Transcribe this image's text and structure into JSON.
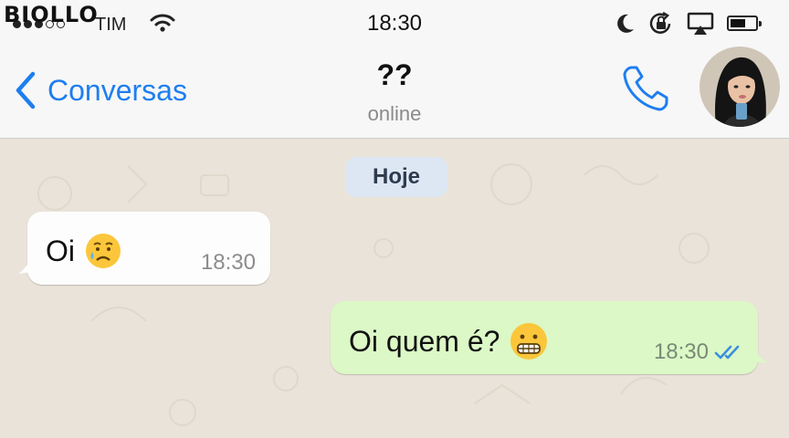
{
  "watermark": "BIOLLO",
  "status_bar": {
    "carrier": "TIM",
    "time": "18:30",
    "icons": [
      "signal-dots-icon",
      "wifi-icon",
      "moon-icon",
      "rotation-lock-icon",
      "airplay-icon",
      "battery-icon"
    ]
  },
  "nav": {
    "back_label": "Conversas",
    "contact_name": "??",
    "contact_status": "online",
    "icons": [
      "chevron-left-icon",
      "phone-icon"
    ]
  },
  "chat": {
    "date_label": "Hoje",
    "messages": [
      {
        "direction": "incoming",
        "text": "Oi",
        "emoji": "sad-sweat-face-emoji",
        "time": "18:30"
      },
      {
        "direction": "outgoing",
        "text": "Oi quem é?",
        "emoji": "grimacing-face-emoji",
        "time": "18:30",
        "status": "read-double-check-icon"
      }
    ]
  },
  "colors": {
    "accent_blue": "#1e7ef0",
    "outgoing_bubble": "#dbf8c6",
    "incoming_bubble": "#fdfdfd",
    "chat_background": "#eae3d9",
    "date_pill": "#dde7f3",
    "read_ticks": "#3b8fe0"
  }
}
